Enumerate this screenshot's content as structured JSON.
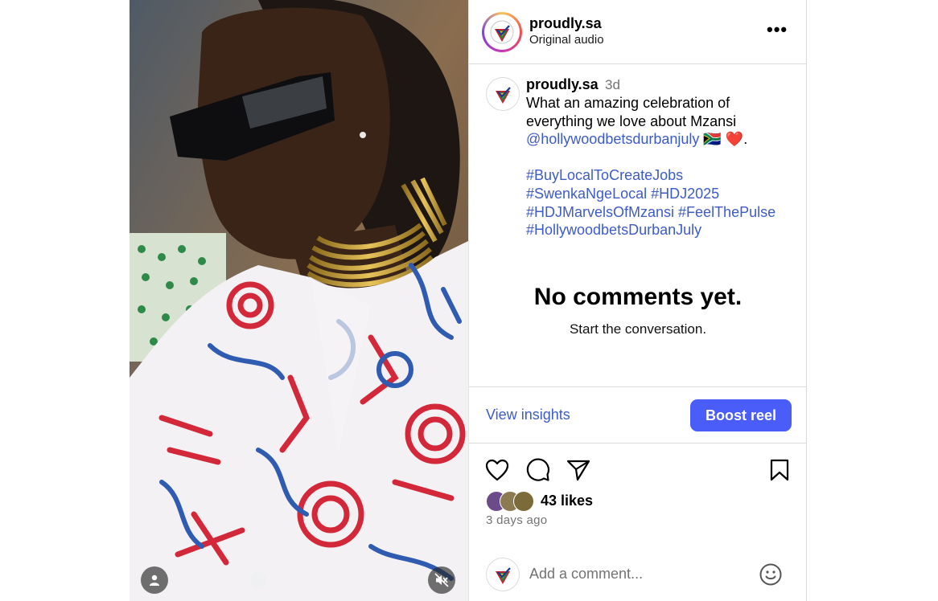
{
  "header": {
    "username": "proudly.sa",
    "audio": "Original audio",
    "more_glyph": "•••"
  },
  "caption": {
    "username": "proudly.sa",
    "time": "3d",
    "lines": [
      "What an amazing celebration of",
      "everything we love about Mzansi"
    ],
    "mention": "@hollywoodbetsdurbanjuly",
    "mention_tail": " 🇿🇦 ❤️.",
    "hashtag_lines": [
      "#BuyLocalToCreateJobs",
      "#SwenkaNgeLocal #HDJ2025",
      "#HDJMarvelsOfMzansi #FeelThePulse",
      "#HollywoodbetsDurbanJuly"
    ]
  },
  "comments": {
    "empty_title": "No comments yet.",
    "empty_subtitle": "Start the conversation."
  },
  "insights": {
    "view_label": "View insights",
    "boost_label": "Boost reel"
  },
  "actions": {
    "icons": [
      "heart-icon",
      "comment-icon",
      "share-icon",
      "bookmark-icon"
    ]
  },
  "likes": {
    "text": "43 likes",
    "ago": "3 days ago"
  },
  "composer": {
    "placeholder": "Add a comment..."
  },
  "colors": {
    "link": "#3e5cc5",
    "boost_button": "#4a5df9",
    "muted_text": "#737373",
    "border": "#dbdbdb"
  }
}
